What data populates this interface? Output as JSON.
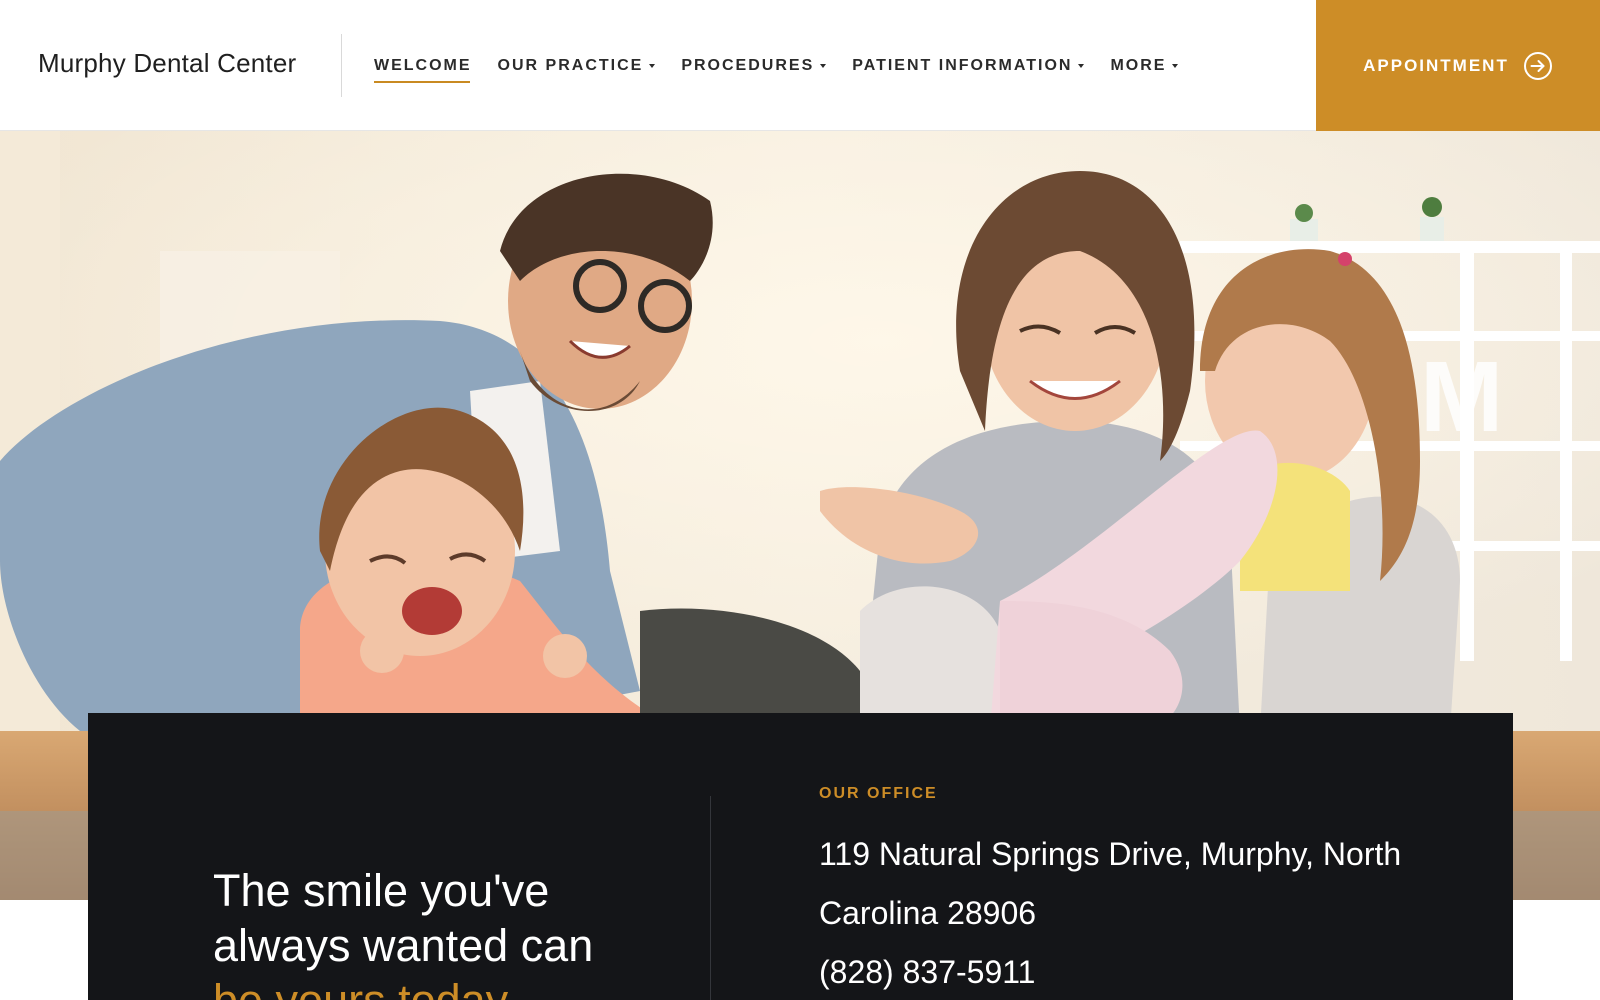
{
  "header": {
    "logo": "Murphy Dental Center",
    "nav": [
      {
        "label": "WELCOME",
        "active": true,
        "dropdown": false
      },
      {
        "label": "OUR PRACTICE",
        "active": false,
        "dropdown": true
      },
      {
        "label": "PROCEDURES",
        "active": false,
        "dropdown": true
      },
      {
        "label": "PATIENT INFORMATION",
        "active": false,
        "dropdown": true
      },
      {
        "label": "MORE",
        "active": false,
        "dropdown": true
      }
    ],
    "appointment_label": "APPOINTMENT",
    "appointment_icon": "arrow-right-circle-icon"
  },
  "hero": {
    "image": "family-laughing-photo"
  },
  "panel": {
    "tagline_line1": "The smile you've",
    "tagline_line2": "always wanted can",
    "tagline_accent": "be yours today.",
    "office_label": "OUR OFFICE",
    "address": "119 Natural Springs Drive, Murphy, North Carolina 28906",
    "phone": "(828) 837-5911"
  },
  "colors": {
    "accent": "#cd8d27",
    "panel_bg": "#141518",
    "text_dark": "#1f1f1f"
  }
}
